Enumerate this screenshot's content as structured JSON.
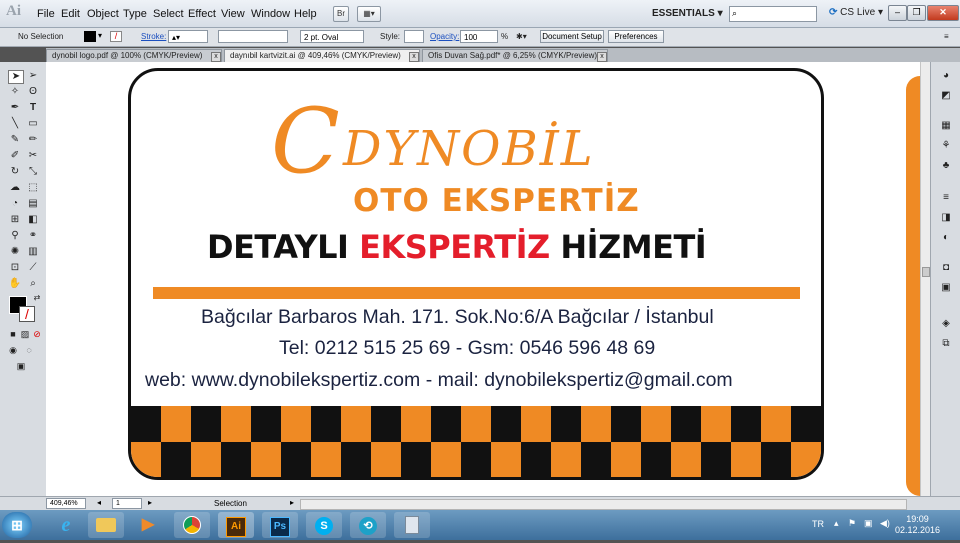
{
  "app": {
    "logo": "Ai"
  },
  "menu": [
    "File",
    "Edit",
    "Object",
    "Type",
    "Select",
    "Effect",
    "View",
    "Window",
    "Help"
  ],
  "workspace": {
    "essentials": "ESSENTIALS",
    "cs_live": "CS Live"
  },
  "controlbar": {
    "selection": "No Selection",
    "stroke_label": "Stroke:",
    "brush": "2 pt. Oval",
    "style_label": "Style:",
    "opacity_label": "Opacity:",
    "opacity_value": "100",
    "percent": "%",
    "document_setup": "Document Setup",
    "preferences": "Preferences"
  },
  "tabs": [
    {
      "label": "dynobil logo.pdf @ 100% (CMYK/Preview)",
      "active": false
    },
    {
      "label": "daynıbil kartvizit.ai @ 409,46% (CMYK/Preview)",
      "active": true
    },
    {
      "label": "Ofis Duvan Sağ.pdf* @ 6,25% (CMYK/Preview)",
      "active": false
    }
  ],
  "card": {
    "brand_c": "C",
    "brand_name": "DYNOBİL",
    "brand_sub": "OTO EKSPERTİZ",
    "headline": {
      "part1": "DETAYLI ",
      "part2": "EKSPERTİZ",
      "part3": " HİZMETİ"
    },
    "address": "Bağcılar Barbaros Mah. 171. Sok.No:6/A Bağcılar / İstanbul",
    "phone": "Tel: 0212 515 25 69 - Gsm: 0546 596 48 69",
    "web": "web: www.dynobilekspertiz.com  - mail: dynobilekspertiz@gmail.com",
    "colors": {
      "orange": "#ef8a24",
      "red": "#e41e2b",
      "black": "#111111"
    }
  },
  "statusbar": {
    "zoom": "409,46%",
    "page": "1",
    "mode": "Selection"
  },
  "taskbar": {
    "apps": [
      "start",
      "internet-explorer",
      "file-explorer",
      "media-player",
      "chrome",
      "illustrator",
      "photoshop",
      "skype",
      "app",
      "calculator"
    ],
    "ai_label": "Ai",
    "ps_label": "Ps",
    "lang": "TR",
    "time": "19:09",
    "date": "02.12.2016"
  }
}
